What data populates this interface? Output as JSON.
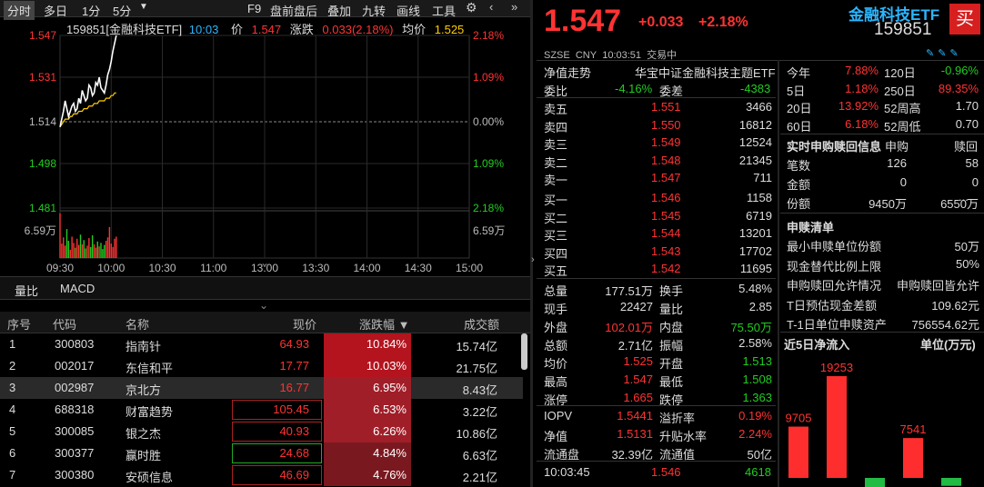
{
  "toolbar": {
    "tabs": [
      "分时",
      "多日",
      "1分",
      "5分"
    ],
    "items": [
      "F9",
      "盘前盘后",
      "叠加",
      "九转",
      "画线",
      "工具"
    ],
    "active": "分时"
  },
  "chart": {
    "title": "159851[金融科技ETF]",
    "time": "10:03",
    "price_label": "价",
    "price": "1.547",
    "chg_label": "涨跌",
    "chg": "0.033(2.18%)",
    "avg_label": "均价",
    "avg": "1.525",
    "y_left": [
      "1.547",
      "1.531",
      "1.514",
      "1.498",
      "1.481"
    ],
    "y_right": [
      "2.18%",
      "1.09%",
      "0.00%",
      "1.09%",
      "2.18%"
    ],
    "vol_left": "6.59万",
    "vol_right": "6.59万",
    "x_ticks": [
      "09:30",
      "10:00",
      "10:30",
      "11:00",
      "13:00",
      "13:30",
      "14:00",
      "14:30",
      "15:00"
    ]
  },
  "chart_data": {
    "type": "line",
    "x": [
      "09:30",
      "09:31",
      "09:32",
      "09:33",
      "09:34",
      "09:35",
      "09:36",
      "09:37",
      "09:38",
      "09:39",
      "09:40",
      "09:41",
      "09:42",
      "09:43",
      "09:44",
      "09:45",
      "09:46",
      "09:47",
      "09:48",
      "09:49",
      "09:50",
      "09:51",
      "09:52",
      "09:53",
      "09:54",
      "09:55",
      "09:56",
      "09:57",
      "09:58",
      "09:59",
      "10:00",
      "10:01",
      "10:02",
      "10:03"
    ],
    "series": [
      {
        "name": "价",
        "values": [
          1.512,
          1.515,
          1.518,
          1.522,
          1.519,
          1.516,
          1.518,
          1.52,
          1.521,
          1.518,
          1.519,
          1.523,
          1.521,
          1.526,
          1.524,
          1.522,
          1.523,
          1.528,
          1.527,
          1.524,
          1.525,
          1.529,
          1.528,
          1.531,
          1.527,
          1.526,
          1.525,
          1.528,
          1.532,
          1.534,
          1.537,
          1.541,
          1.544,
          1.547
        ]
      },
      {
        "name": "均价",
        "values": [
          1.512,
          1.513,
          1.514,
          1.515,
          1.515,
          1.515,
          1.516,
          1.516,
          1.517,
          1.517,
          1.517,
          1.518,
          1.518,
          1.518,
          1.519,
          1.519,
          1.519,
          1.52,
          1.52,
          1.52,
          1.521,
          1.521,
          1.521,
          1.522,
          1.522,
          1.522,
          1.522,
          1.523,
          1.523,
          1.523,
          1.524,
          1.524,
          1.525,
          1.525
        ]
      }
    ],
    "volume": [
      6.5,
      2.1,
      3.0,
      1.8,
      4.2,
      2.5,
      1.2,
      3.1,
      2.2,
      1.5,
      2.8,
      1.9,
      3.4,
      2.0,
      2.6,
      1.4,
      1.8,
      2.9,
      1.6,
      3.3,
      2.0,
      1.5,
      2.4,
      1.7,
      2.2,
      1.3,
      1.9,
      2.5,
      3.0,
      4.5,
      2.1,
      1.6,
      2.8,
      3.1
    ],
    "ylim": [
      1.481,
      1.547
    ],
    "vol_max": 6.59
  },
  "bottom_tabs": [
    "量比",
    "MACD"
  ],
  "table": {
    "headers": [
      "序号",
      "代码",
      "名称",
      "现价",
      "涨跌幅 ▼",
      "成交额"
    ],
    "rows": [
      [
        "1",
        "300803",
        "指南针",
        "64.93",
        "10.84%",
        "15.74亿"
      ],
      [
        "2",
        "002017",
        "东信和平",
        "17.77",
        "10.03%",
        "21.75亿"
      ],
      [
        "3",
        "002987",
        "京北方",
        "16.77",
        "6.95%",
        "8.43亿"
      ],
      [
        "4",
        "688318",
        "财富趋势",
        "105.45",
        "6.53%",
        "3.22亿"
      ],
      [
        "5",
        "300085",
        "银之杰",
        "40.93",
        "6.26%",
        "10.86亿"
      ],
      [
        "6",
        "300377",
        "赢时胜",
        "24.68",
        "4.84%",
        "6.63亿"
      ],
      [
        "7",
        "300380",
        "安硕信息",
        "46.69",
        "4.76%",
        "2.21亿"
      ]
    ]
  },
  "quote": {
    "price": "1.547",
    "chg": "+0.033",
    "pct": "+2.18%",
    "name": "金融科技ETF",
    "code": "159851",
    "exchange": "SZSE",
    "currency": "CNY",
    "time": "10:03:51",
    "status": "交易中",
    "buy": "买",
    "nav_label": "净值走势",
    "fund_name": "华宝中证金融科技主题ETF",
    "wb": {
      "l1": "委比",
      "v1": "-4.16%",
      "l2": "委差",
      "v2": "-4383"
    },
    "asks": [
      [
        "卖五",
        "1.551",
        "3466"
      ],
      [
        "卖四",
        "1.550",
        "16812"
      ],
      [
        "卖三",
        "1.549",
        "12524"
      ],
      [
        "卖二",
        "1.548",
        "21345"
      ],
      [
        "卖一",
        "1.547",
        "711"
      ]
    ],
    "bids": [
      [
        "买一",
        "1.546",
        "1158"
      ],
      [
        "买二",
        "1.545",
        "6719"
      ],
      [
        "买三",
        "1.544",
        "13201"
      ],
      [
        "买四",
        "1.543",
        "17702"
      ],
      [
        "买五",
        "1.542",
        "11695"
      ]
    ],
    "stats": [
      [
        "总量",
        "177.51万",
        "换手",
        "5.48%"
      ],
      [
        "现手",
        "22427",
        "量比",
        "2.85"
      ],
      [
        "外盘",
        "102.01万",
        "内盘",
        "75.50万"
      ],
      [
        "总额",
        "2.71亿",
        "振幅",
        "2.58%"
      ],
      [
        "均价",
        "1.525",
        "开盘",
        "1.513"
      ],
      [
        "最高",
        "1.547",
        "最低",
        "1.508"
      ],
      [
        "涨停",
        "1.665",
        "跌停",
        "1.363"
      ]
    ],
    "iopv": [
      [
        "IOPV",
        "1.5441",
        "溢折率",
        "0.19%"
      ],
      [
        "净值",
        "1.5131",
        "升贴水率",
        "2.24%"
      ],
      [
        "流通盘",
        "32.39亿",
        "流通值",
        "50亿"
      ]
    ],
    "tick": [
      "10:03:45",
      "1.546",
      "4618"
    ]
  },
  "side": {
    "perf": [
      [
        "今年",
        "7.88%",
        "120日",
        "-0.96%"
      ],
      [
        "5日",
        "1.18%",
        "250日",
        "89.35%"
      ],
      [
        "20日",
        "13.92%",
        "52周高",
        "1.70"
      ],
      [
        "60日",
        "6.18%",
        "52周低",
        "0.70"
      ]
    ],
    "sr_title": "实时申购赎回信息",
    "sr_h1": "申购",
    "sr_h2": "赎回",
    "sr_rows": [
      [
        "笔数",
        "126",
        "58"
      ],
      [
        "金额",
        "0",
        "0"
      ],
      [
        "份额",
        "9450万",
        "6550万"
      ]
    ],
    "more": "...",
    "list_title": "申赎清单",
    "list": [
      [
        "最小申赎单位份额",
        "50万"
      ],
      [
        "现金替代比例上限",
        "50%"
      ],
      [
        "申购赎回允许情况",
        "申购赎回皆允许"
      ],
      [
        "T日预估现金差额",
        "109.62元"
      ],
      [
        "T-1日单位申赎资产",
        "756554.62元"
      ]
    ],
    "flow_title": "近5日净流入",
    "flow_unit": "单位(万元)",
    "flow_values": [
      9705,
      19253,
      -1800,
      7541,
      -1500
    ]
  }
}
